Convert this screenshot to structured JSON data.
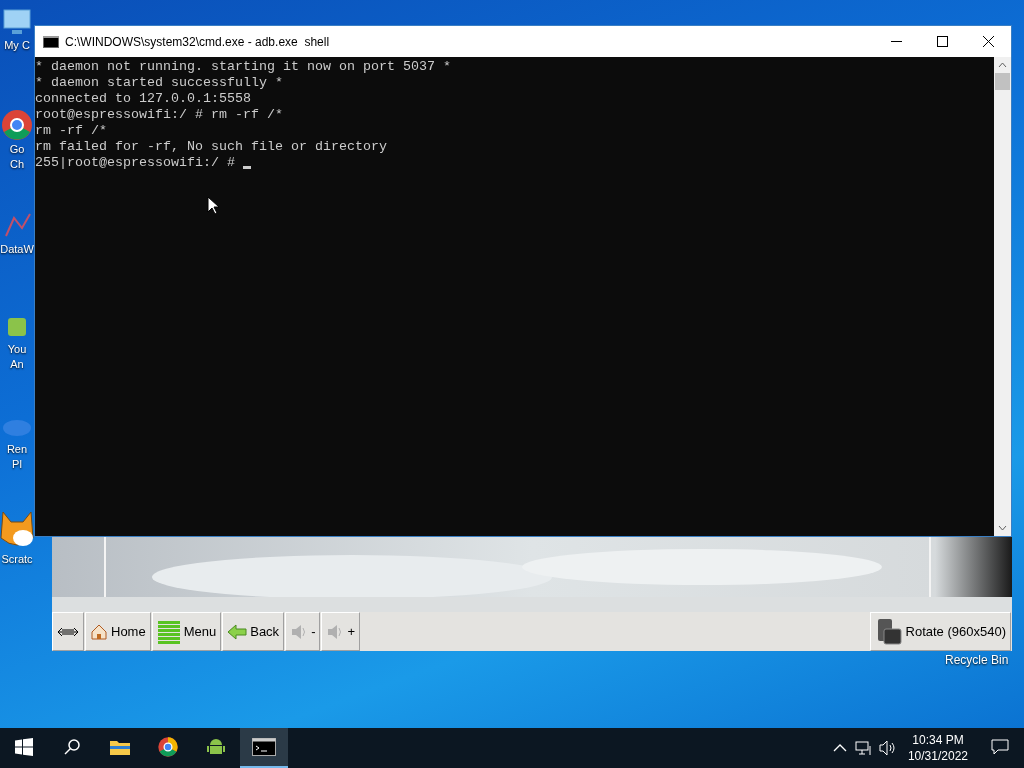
{
  "desktop_icons": [
    {
      "kind": "computer",
      "lines": [
        "My C"
      ]
    },
    {
      "kind": "chrome",
      "lines": [
        "Go",
        "Ch"
      ]
    },
    {
      "kind": "data",
      "lines": [
        "DataW"
      ]
    },
    {
      "kind": "android",
      "lines": [
        "You",
        "An"
      ]
    },
    {
      "kind": "ren",
      "lines": [
        "Ren",
        "Pl"
      ]
    },
    {
      "kind": "scratch",
      "lines": [
        "Scratc"
      ]
    }
  ],
  "recycle_bin": {
    "label": "Recycle Bin"
  },
  "console_window": {
    "title": "C:\\WINDOWS\\system32\\cmd.exe - adb.exe  shell",
    "lines": [
      "* daemon not running. starting it now on port 5037 *",
      "* daemon started successfully *",
      "connected to 127.0.0.1:5558",
      "root@espressowifi:/ # rm -rf /*",
      "rm -rf /*",
      "rm failed for -rf, No such file or directory",
      "255|root@espressowifi:/ # "
    ]
  },
  "emulator": {
    "buttons": [
      {
        "kind": "resize"
      },
      {
        "kind": "home",
        "label": "Home"
      },
      {
        "kind": "menu",
        "label": "Menu"
      },
      {
        "kind": "back",
        "label": "Back"
      },
      {
        "kind": "volume",
        "label": "-"
      },
      {
        "kind": "volume",
        "label": "+"
      }
    ],
    "rotate": {
      "label": "Rotate (960x540)"
    }
  },
  "taskbar": {
    "apps": [
      {
        "kind": "explorer",
        "active": false
      },
      {
        "kind": "chrome",
        "active": false
      },
      {
        "kind": "android",
        "active": false
      },
      {
        "kind": "console",
        "active": true
      }
    ],
    "time": "10:34 PM",
    "date": "10/31/2022"
  }
}
